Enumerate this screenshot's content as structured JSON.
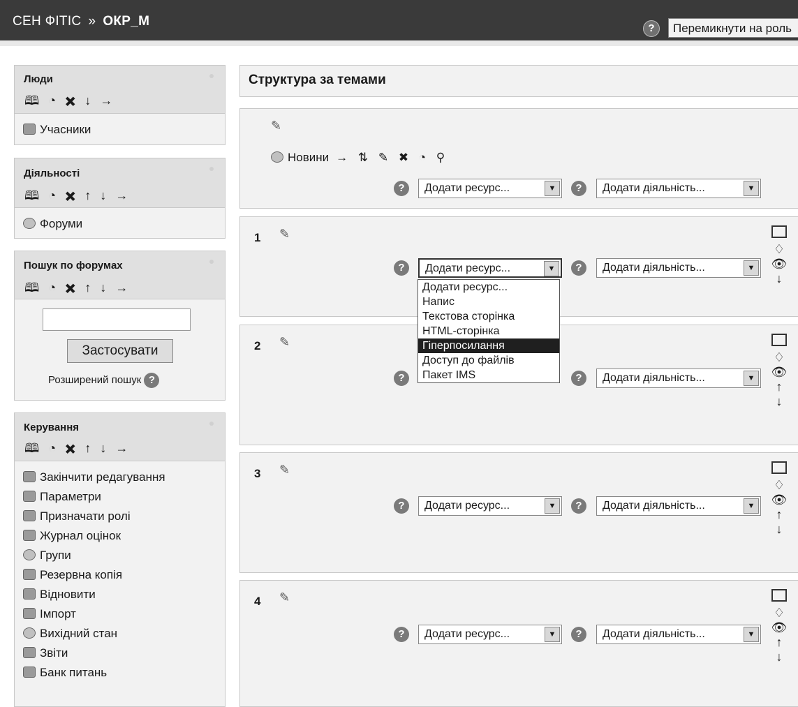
{
  "header": {
    "course": "СЕН ФІТІС",
    "separator": "»",
    "current": "ОКР_М",
    "help_glyph": "?",
    "role_switch": "Перемикнути на роль"
  },
  "block_icons": "🕮 ◔ ✖ ↑ ↓ →",
  "sidebar": {
    "people": {
      "title": "Люди",
      "icons": "🕮 ◔ ✖ ↓ →",
      "items": [
        {
          "label": "Учасники",
          "icon": "users-icon"
        }
      ]
    },
    "activities": {
      "title": "Діяльності",
      "icons": "🕮 ◔ ✖ ↑ ↓ →",
      "items": [
        {
          "label": "Форуми",
          "icon": "forum-icon"
        }
      ]
    },
    "forum_search": {
      "title": "Пошук по форумах",
      "icons": "🕮 ◔ ✖ ↑ ↓ →",
      "input_value": "",
      "apply": "Застосувати",
      "advanced": "Розширений пошук"
    },
    "admin": {
      "title": "Керування",
      "icons": "🕮 ◔ ✖ ↑ ↓ →",
      "items": [
        {
          "label": "Закінчити редагування",
          "icon": "edit-icon"
        },
        {
          "label": "Параметри",
          "icon": "settings-icon"
        },
        {
          "label": "Призначати ролі",
          "icon": "roles-icon"
        },
        {
          "label": "Журнал оцінок",
          "icon": "grades-icon"
        },
        {
          "label": "Групи",
          "icon": "groups-icon"
        },
        {
          "label": "Резервна копія",
          "icon": "backup-icon"
        },
        {
          "label": "Відновити",
          "icon": "restore-icon"
        },
        {
          "label": "Імпорт",
          "icon": "import-icon"
        },
        {
          "label": "Вихідний стан",
          "icon": "reset-icon"
        },
        {
          "label": "Звіти",
          "icon": "reports-icon"
        },
        {
          "label": "Банк питань",
          "icon": "question-bank-icon"
        }
      ]
    }
  },
  "main": {
    "title": "Структура за темами",
    "news": {
      "label": "Новини",
      "actions": "→ ⇅ ✎ ✖ ◔ ⚲"
    },
    "add_resource": "Додати ресурс...",
    "add_activity": "Додати діяльність...",
    "sections": [
      {
        "number": "1"
      },
      {
        "number": "2"
      },
      {
        "number": "3"
      },
      {
        "number": "4"
      }
    ],
    "dropdown_options": [
      "Додати ресурс...",
      "Напис",
      "Текстова сторінка",
      "HTML-сторінка",
      "Гіперпосилання",
      "Доступ до файлів",
      "Пакет IMS"
    ],
    "dropdown_selected": "Гіперпосилання"
  }
}
